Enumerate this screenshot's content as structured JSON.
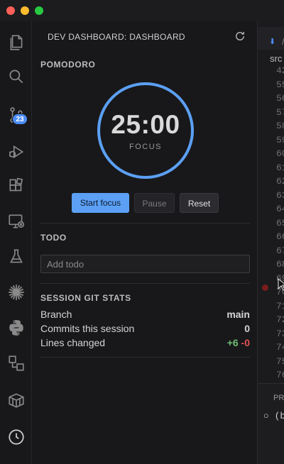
{
  "sidebar": {
    "title": "DEV DASHBOARD: DASHBOARD",
    "pomodoro": {
      "section_title": "POMODORO",
      "time": "25:00",
      "mode": "FOCUS",
      "progress": 1.0,
      "start_label": "Start focus",
      "pause_label": "Pause",
      "reset_label": "Reset"
    },
    "todo": {
      "section_title": "TODO",
      "input_value": "",
      "placeholder": "Add todo"
    },
    "git_stats": {
      "section_title": "SESSION GIT STATS",
      "branch_label": "Branch",
      "branch_value": "main",
      "commits_label": "Commits this session",
      "commits_value": "0",
      "lines_label": "Lines changed",
      "lines_added": "+6",
      "lines_removed": "-0"
    }
  },
  "activity_bar": {
    "items": [
      "files-icon",
      "search-icon",
      "source-control-icon",
      "run-debug-icon",
      "extensions-icon",
      "remote-explorer-icon",
      "testing-icon",
      "sparkle-icon",
      "python-icon",
      "pipeline-icon",
      "package-icon",
      "clock-icon"
    ],
    "source_control_badge": "23"
  },
  "editor": {
    "tab_text": "/",
    "breadcrumb": "src",
    "line_numbers": [
      "42",
      "55",
      "56",
      "57",
      "58",
      "59",
      "60",
      "61",
      "62",
      "63",
      "64",
      "65",
      "66",
      "67",
      "68",
      "69",
      "70",
      "71",
      "72",
      "73",
      "74",
      "75",
      "76"
    ],
    "panel_title": "PR",
    "panel_line": "(b"
  },
  "colors": {
    "accent": "#5ba0f5",
    "added": "#6fbf73",
    "removed": "#e05252"
  }
}
